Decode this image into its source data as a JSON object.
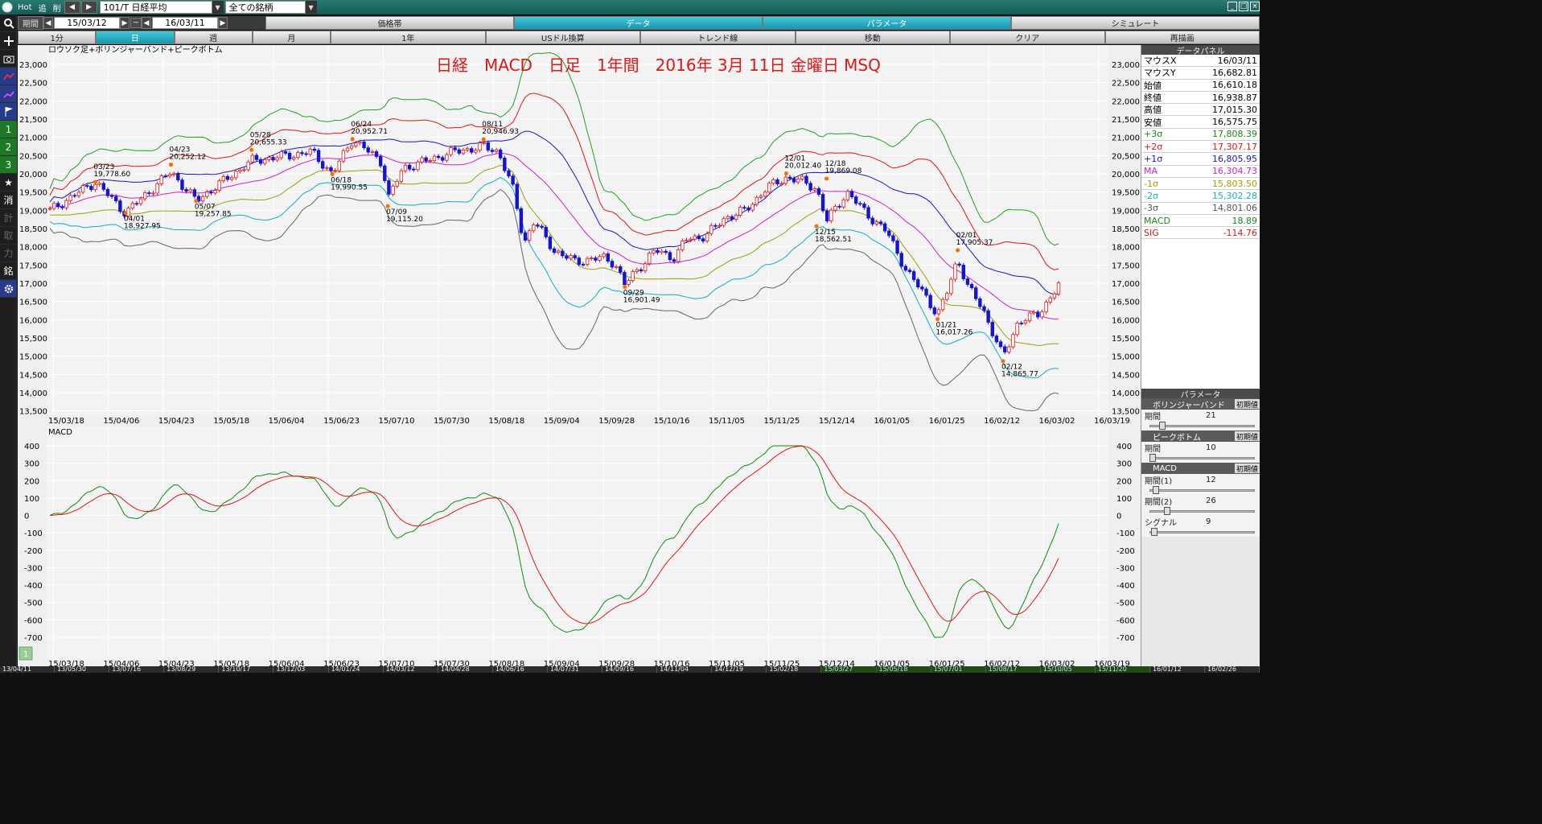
{
  "toolbar": {
    "hot": "Hot",
    "ma_label": "追",
    "del_label": "削",
    "symbol": "101/T 日経平均",
    "group": "全ての銘柄"
  },
  "period_row": {
    "label": "期間",
    "from": "15/03/12",
    "tilde": "~",
    "to": "16/03/11",
    "tabs": [
      "価格帯",
      "データ",
      "パラメータ",
      "シミュレート"
    ]
  },
  "timeframe_row": {
    "items": [
      "1分",
      "日",
      "週",
      "月",
      "1年",
      "USドル換算",
      "トレンド線",
      "移動",
      "クリア",
      "再描画"
    ]
  },
  "sidebar": {
    "icons": [
      "search-icon",
      "plus-icon",
      "camera-icon",
      "chart-icon",
      "line-chart-icon",
      "flag-icon",
      "one",
      "two",
      "three",
      "star-icon",
      "消",
      "計",
      "取",
      "力",
      "銘",
      "gear-icon"
    ],
    "labels": [
      "1",
      "2",
      "3",
      "消",
      "計",
      "取",
      "力",
      "銘"
    ]
  },
  "chart": {
    "title": "日経　MACD　日足　1年間　2016年 3月 11日 金曜日 MSQ",
    "legend": "ロウソク足+ボリンジャーバンド+ピークボトム",
    "macd_label": "MACD",
    "y_ticks": [
      "23,000",
      "22,500",
      "22,000",
      "21,500",
      "21,000",
      "20,500",
      "20,000",
      "19,500",
      "19,000",
      "18,500",
      "18,000",
      "17,500",
      "17,000",
      "16,500",
      "16,000",
      "15,500",
      "15,000",
      "14,500",
      "14,000",
      "13,500"
    ],
    "x_ticks": [
      "15/03/18",
      "15/04/06",
      "15/04/23",
      "15/05/18",
      "15/06/04",
      "15/06/23",
      "15/07/10",
      "15/07/30",
      "15/08/18",
      "15/09/04",
      "15/09/28",
      "15/10/16",
      "15/11/05",
      "15/11/25",
      "15/12/14",
      "16/01/05",
      "16/01/25",
      "16/02/12",
      "16/03/02",
      "16/03/19"
    ],
    "macd_ticks": [
      "400",
      "300",
      "200",
      "100",
      "0",
      "-100",
      "-200",
      "-300",
      "-400",
      "-500",
      "-600",
      "-700"
    ],
    "annotations": [
      {
        "d": "03/23",
        "v": "19,778.60"
      },
      {
        "d": "04/01",
        "v": "18,927.95"
      },
      {
        "d": "04/23",
        "v": "20,252.12"
      },
      {
        "d": "05/07",
        "v": "19,257.85"
      },
      {
        "d": "05/28",
        "v": "20,655.33"
      },
      {
        "d": "06/24",
        "v": "20,952.71"
      },
      {
        "d": "06/18",
        "v": "19,990.55"
      },
      {
        "d": "07/09",
        "v": "19,115.20"
      },
      {
        "d": "08/11",
        "v": "20,946.93"
      },
      {
        "d": "09/29",
        "v": "16,901.49"
      },
      {
        "d": "12/01",
        "v": "20,012.40"
      },
      {
        "d": "12/18",
        "v": "19,869.08"
      },
      {
        "d": "12/15",
        "v": "18,562.51"
      },
      {
        "d": "01/21",
        "v": "16,017.26"
      },
      {
        "d": "02/01",
        "v": "17,905.37"
      },
      {
        "d": "02/12",
        "v": "14,865.77"
      }
    ],
    "page_num": "1"
  },
  "chart_data": {
    "type": "line",
    "close_series": {
      "name": "終値",
      "x": [
        "15/03/12",
        "15/03/23",
        "15/04/01",
        "15/04/23",
        "15/05/07",
        "15/05/28",
        "15/06/18",
        "15/06/24",
        "15/07/09",
        "15/08/11",
        "15/09/29",
        "15/12/01",
        "15/12/15",
        "15/12/18",
        "16/01/21",
        "16/02/01",
        "16/02/12",
        "16/03/11"
      ],
      "values": [
        18991,
        19778,
        18928,
        20252,
        19258,
        20655,
        19991,
        20953,
        19115,
        20947,
        16901,
        20012,
        18563,
        19869,
        16017,
        17905,
        14866,
        16939
      ]
    },
    "ylim_price": [
      13500,
      23000
    ],
    "ylim_macd": [
      -700,
      400
    ]
  },
  "panel": {
    "title": "データパネル",
    "rows": [
      {
        "k": "マウスX",
        "v": "16/03/11",
        "c": "#000000"
      },
      {
        "k": "マウスY",
        "v": "16,682.81",
        "c": "#000000"
      },
      {
        "k": "始値",
        "v": "16,610.18",
        "c": "#000000"
      },
      {
        "k": "終値",
        "v": "16,938.87",
        "c": "#000000"
      },
      {
        "k": "高値",
        "v": "17,015.30",
        "c": "#000000"
      },
      {
        "k": "安値",
        "v": "16,575.75",
        "c": "#000000"
      },
      {
        "k": "+3σ",
        "v": "17,808.39",
        "c": "#138a13"
      },
      {
        "k": "+2σ",
        "v": "17,307.17",
        "c": "#e01515"
      },
      {
        "k": "+1σ",
        "v": "16,805.95",
        "c": "#1515d0"
      },
      {
        "k": "MA",
        "v": "16,304.73",
        "c": "#d020d0"
      },
      {
        "k": "-1σ",
        "v": "15,803.50",
        "c": "#a0a000"
      },
      {
        "k": "-2σ",
        "v": "15,302.28",
        "c": "#10b0c0"
      },
      {
        "k": "-3σ",
        "v": "14,801.06",
        "c": "#555555"
      },
      {
        "k": "MACD",
        "v": "18.89",
        "c": "#138a13"
      },
      {
        "k": "SIG",
        "v": "-114.76",
        "c": "#e01515"
      }
    ],
    "param_title": "パラメータ",
    "reset": "初期値",
    "sections": [
      {
        "name": "ボリンジャーバンド",
        "params": [
          {
            "k": "期間",
            "v": "21"
          }
        ]
      },
      {
        "name": "ピークボトム",
        "params": [
          {
            "k": "期間",
            "v": "10"
          }
        ]
      },
      {
        "name": "MACD",
        "params": [
          {
            "k": "期間(1)",
            "v": "12"
          },
          {
            "k": "期間(2)",
            "v": "26"
          },
          {
            "k": "シグナル",
            "v": "9"
          }
        ]
      }
    ]
  },
  "bottombar": [
    "13/04/11",
    "13/05/30",
    "13/07/16",
    "13/08/29",
    "13/10/17",
    "13/12/03",
    "14/01/24",
    "14/03/12",
    "14/04/28",
    "14/06/16",
    "14/07/31",
    "14/09/16",
    "14/11/04",
    "14/12/19",
    "15/02/18",
    "15/03/27",
    "15/05/18",
    "15/07/01",
    "15/08/17",
    "15/10/05",
    "15/11/20",
    "16/01/12",
    "16/02/26"
  ]
}
